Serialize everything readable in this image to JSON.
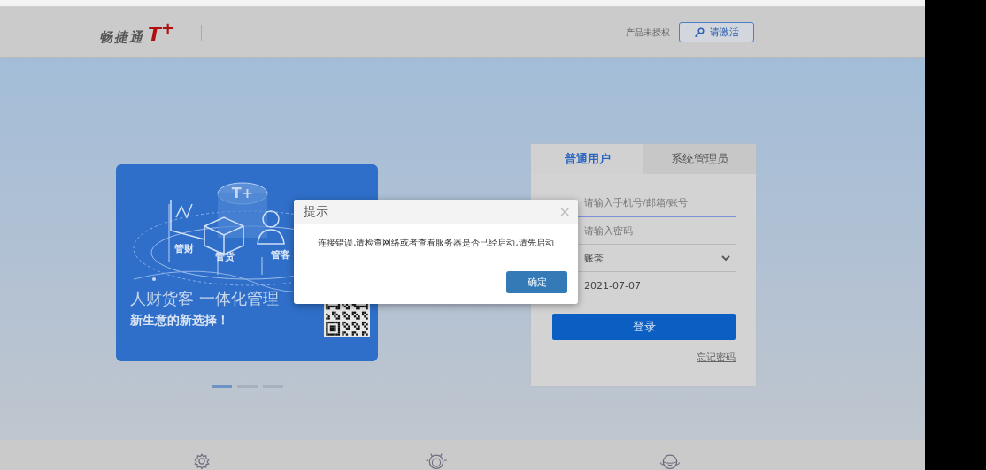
{
  "header": {
    "logo_text": "畅捷通",
    "logo_mark": "T$^{+}$",
    "license_status": "产品未授权",
    "activate_button": "请激活"
  },
  "banner": {
    "illustration_badge": "T+",
    "illustration_labels": [
      "管财",
      "管货",
      "管客"
    ],
    "headline": "人财货客 一体化管理",
    "tagline": "新生意的新选择！",
    "slides": [
      {
        "selected": true
      },
      {
        "selected": false
      },
      {
        "selected": false
      }
    ]
  },
  "login": {
    "tabs": [
      {
        "label": "普通用户",
        "selected": true
      },
      {
        "label": "系统管理员",
        "selected": false
      }
    ],
    "fields": [
      {
        "kind": "text",
        "placeholder": "请输入手机号/邮箱/账号",
        "focused": true
      },
      {
        "kind": "password",
        "placeholder": "请输入密码",
        "focused": false
      },
      {
        "kind": "select",
        "value": "账套",
        "focused": false
      },
      {
        "kind": "date",
        "value": "2021-07-07",
        "focused": false
      }
    ],
    "submit": "登录",
    "forgot_link": "忘记密码"
  },
  "dialog": {
    "title": "提示",
    "close": "×",
    "message": "连接错误,请检查网络或者查看服务器是否已经启动,请先启动",
    "confirm": "确定"
  }
}
